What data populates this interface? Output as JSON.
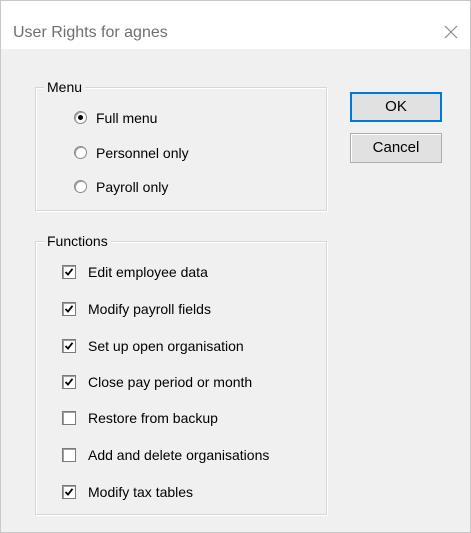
{
  "window": {
    "title": "User Rights for agnes"
  },
  "menu_group": {
    "label": "Menu",
    "options": [
      {
        "label": "Full menu",
        "selected": true
      },
      {
        "label": "Personnel only",
        "selected": false
      },
      {
        "label": "Payroll only",
        "selected": false
      }
    ]
  },
  "functions_group": {
    "label": "Functions",
    "items": [
      {
        "label": "Edit employee data",
        "checked": true
      },
      {
        "label": "Modify payroll fields",
        "checked": true
      },
      {
        "label": "Set up open organisation",
        "checked": true
      },
      {
        "label": "Close pay period or month",
        "checked": true
      },
      {
        "label": "Restore from backup",
        "checked": false
      },
      {
        "label": "Add and delete organisations",
        "checked": false
      },
      {
        "label": "Modify tax tables",
        "checked": true
      }
    ]
  },
  "buttons": {
    "ok_label": "OK",
    "cancel_label": "Cancel"
  }
}
